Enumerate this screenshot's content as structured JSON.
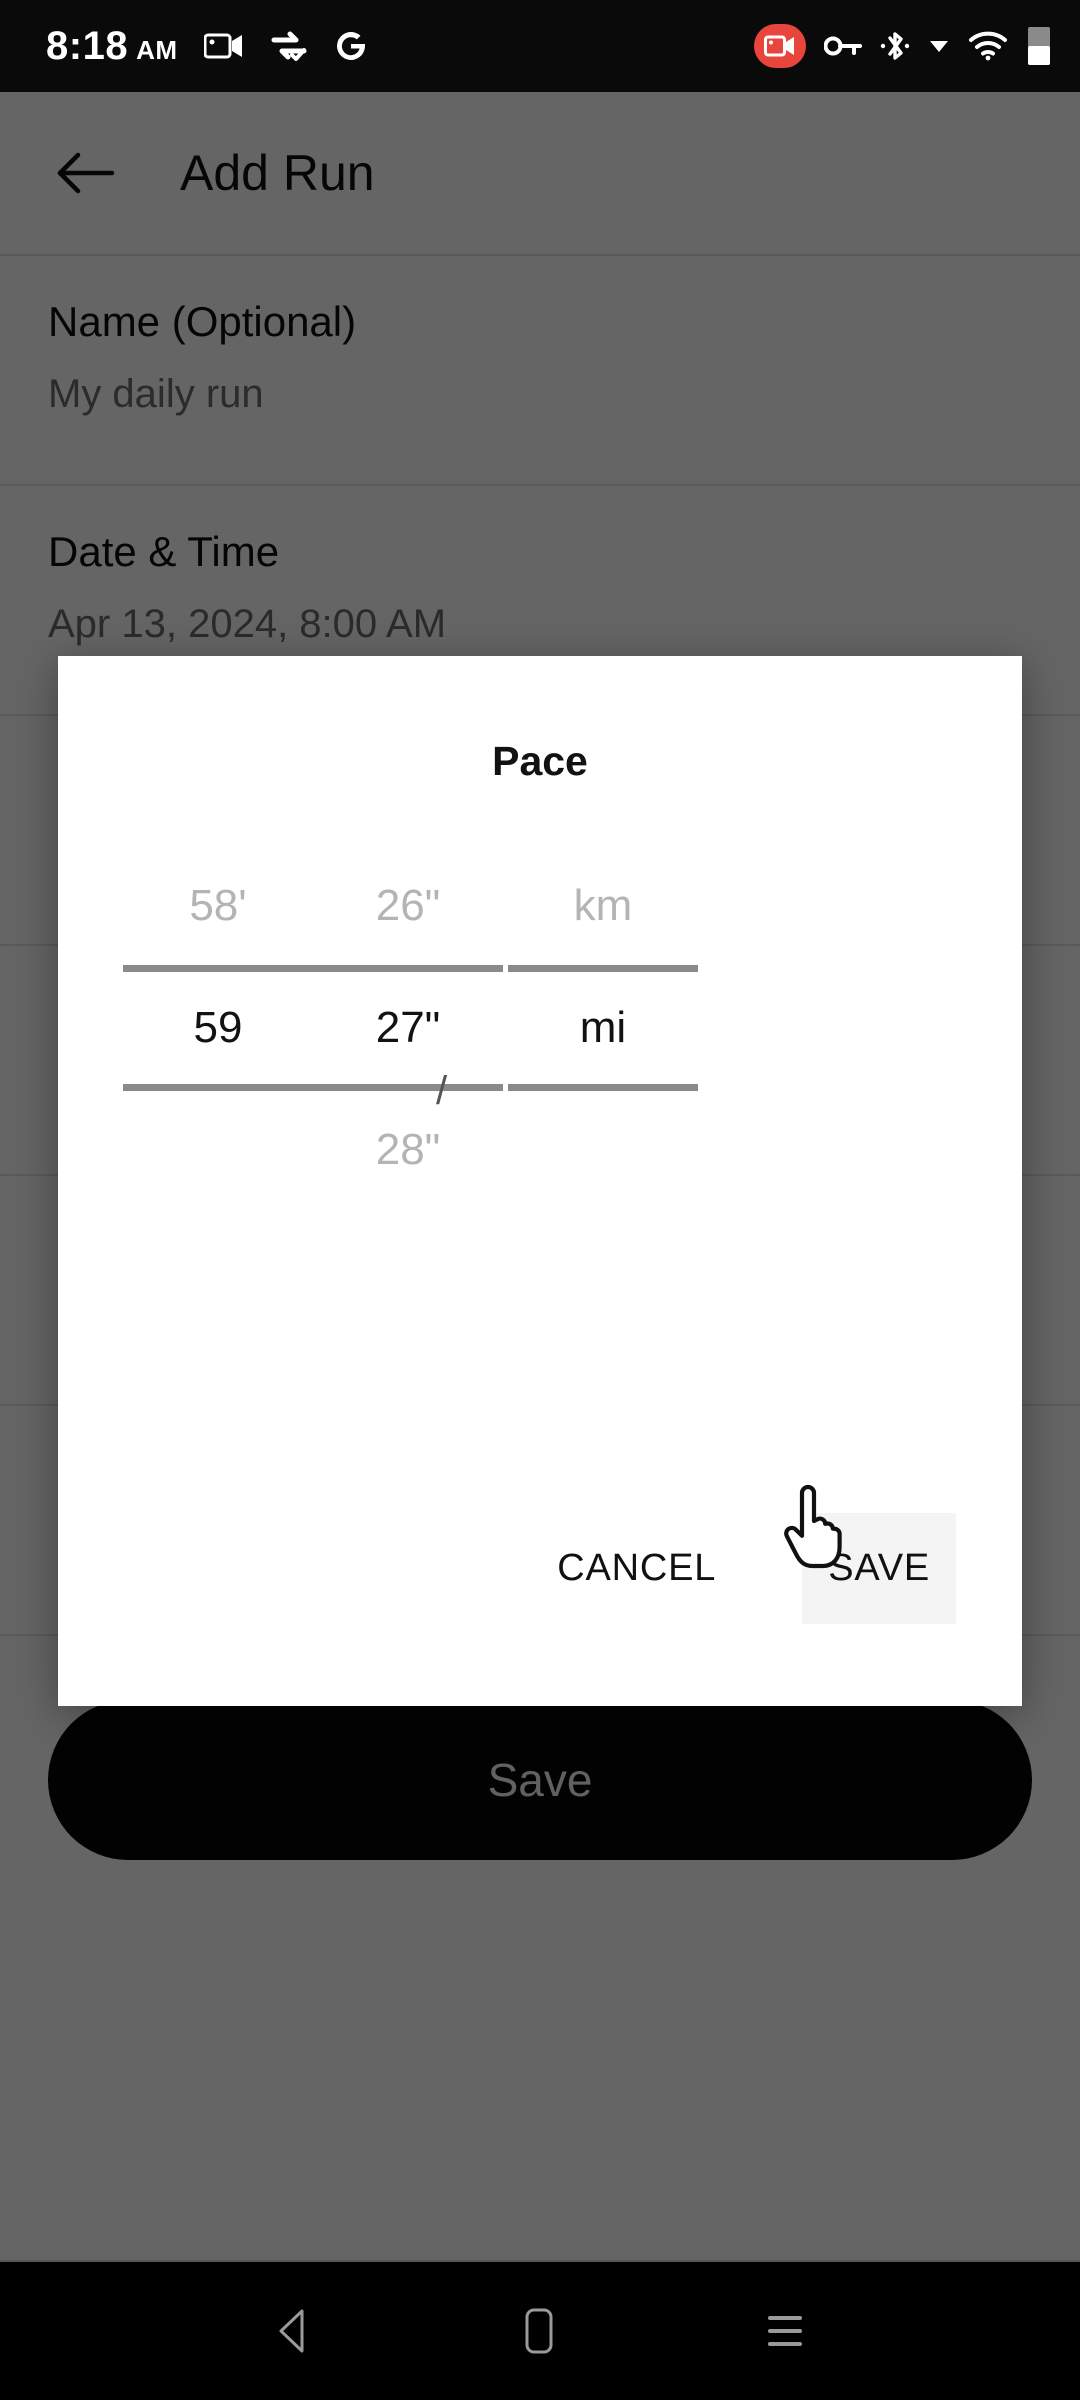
{
  "status_bar": {
    "time": "8:18",
    "ampm": "AM",
    "icons_left": [
      "video-camera-icon",
      "sync-check-icon",
      "google-g-icon"
    ],
    "icons_right": [
      "screen-record-badge-icon",
      "vpn-key-icon",
      "bluetooth-icon",
      "caret-down-icon",
      "wifi-icon",
      "battery-icon"
    ],
    "background": "#0a0a0a",
    "record_badge_color": "#e8453c"
  },
  "appbar": {
    "back_icon": "arrow-left-icon",
    "title": "Add Run"
  },
  "form": {
    "fields": [
      {
        "label": "Name (Optional)",
        "value": "My daily run"
      },
      {
        "label": "Date & Time",
        "value": "Apr 13, 2024, 8:00 AM"
      }
    ],
    "save_label": "Save",
    "save_background": "#050505"
  },
  "dialog": {
    "title": "Pace",
    "separator": "/",
    "picker": {
      "minutes": {
        "above": "58'",
        "selected": "59",
        "below": ""
      },
      "seconds": {
        "above": "26\"",
        "selected": "27\"",
        "below": "28\""
      },
      "units": {
        "above": "km",
        "selected": "mi",
        "below": ""
      }
    },
    "cancel_label": "CANCEL",
    "save_label": "SAVE",
    "save_hover_background": "#f4f4f4"
  },
  "navbar": {
    "items": [
      "back-triangle-icon",
      "home-square-icon",
      "recents-lines-icon"
    ],
    "background": "#000000"
  },
  "cursor": {
    "type": "pointing-hand-cursor"
  },
  "scrim": {
    "color": "rgba(0,0,0,0.60)"
  }
}
